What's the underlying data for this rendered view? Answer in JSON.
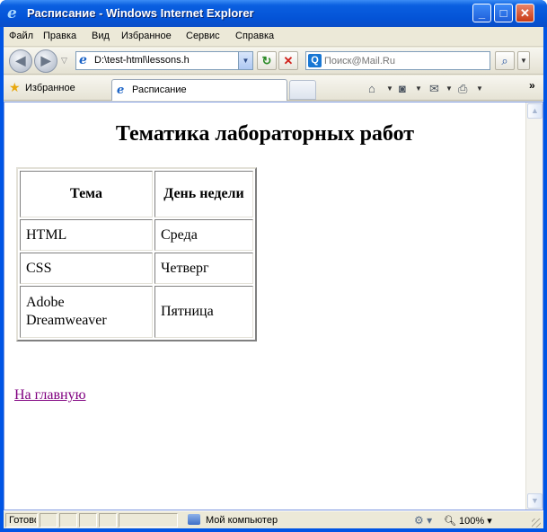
{
  "window": {
    "title": "Расписание - Windows Internet Explorer"
  },
  "menu": [
    "Файл",
    "Правка",
    "Вид",
    "Избранное",
    "Сервис",
    "Справка"
  ],
  "address": {
    "value": "D:\\test-html\\lessons.h"
  },
  "search": {
    "placeholder": "Поиск@Mail.Ru",
    "logo": "Q"
  },
  "favorites": {
    "label": "Избранное"
  },
  "tab": {
    "label": "Расписание"
  },
  "page": {
    "heading": "Тематика лабораторных работ",
    "table": {
      "headers": [
        "Тема",
        "День недели"
      ],
      "rows": [
        [
          "HTML",
          "Среда"
        ],
        [
          "CSS",
          "Четверг"
        ],
        [
          "Adobe Dreamweaver",
          "Пятница"
        ]
      ]
    },
    "home_link": "На главную"
  },
  "status": {
    "text": "Готово",
    "zone": "Мой компьютер",
    "zoom": "100%"
  },
  "icons": {
    "back": "back-arrow-icon",
    "forward": "forward-arrow-icon",
    "refresh": "refresh-icon",
    "stop": "stop-icon",
    "home": "home-icon",
    "feeds": "rss-feed-icon",
    "mail": "mail-icon",
    "print": "print-icon"
  }
}
